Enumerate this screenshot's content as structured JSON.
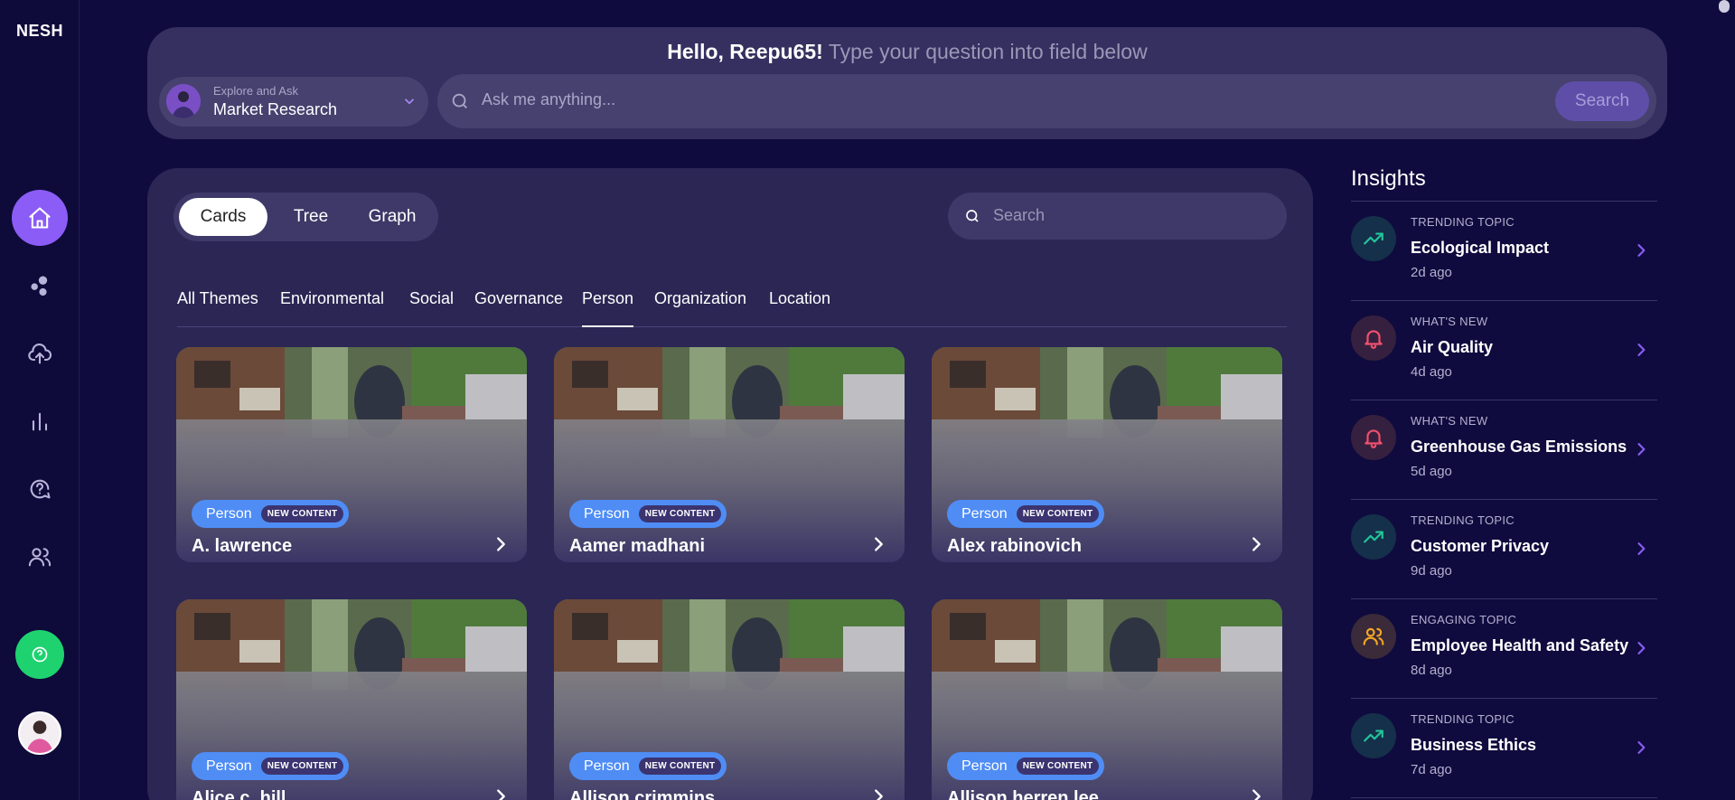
{
  "brand": {
    "name": "NESH"
  },
  "hero": {
    "greeting": "Hello, Reepu65!",
    "prompt": "Type your question into field below",
    "explore_small": "Explore and Ask",
    "explore_selected": "Market Research",
    "ask_placeholder": "Ask me anything...",
    "search_label": "Search"
  },
  "view_toggle": [
    "Cards",
    "Tree",
    "Graph"
  ],
  "main_search_placeholder": "Search",
  "themes": [
    "All Themes",
    "Environmental",
    "Social",
    "Governance",
    "Person",
    "Organization",
    "Location"
  ],
  "active_theme": "Person",
  "cards": [
    {
      "tag": "Person",
      "badge": "NEW CONTENT",
      "name": "A. lawrence"
    },
    {
      "tag": "Person",
      "badge": "NEW CONTENT",
      "name": "Aamer madhani"
    },
    {
      "tag": "Person",
      "badge": "NEW CONTENT",
      "name": "Alex rabinovich"
    },
    {
      "tag": "Person",
      "badge": "NEW CONTENT",
      "name": "Alice c. hill"
    },
    {
      "tag": "Person",
      "badge": "NEW CONTENT",
      "name": "Allison crimmins"
    },
    {
      "tag": "Person",
      "badge": "NEW CONTENT",
      "name": "Allison herren lee"
    }
  ],
  "insights": {
    "title": "Insights",
    "items": [
      {
        "kicker": "TRENDING TOPIC",
        "title": "Ecological Impact",
        "time": "2d ago",
        "icon": "trending-up-icon",
        "color": "#22c59a",
        "bg": "#15304a"
      },
      {
        "kicker": "WHAT'S NEW",
        "title": "Air Quality",
        "time": "4d ago",
        "icon": "bell-icon",
        "color": "#f0506e",
        "bg": "#36203f"
      },
      {
        "kicker": "WHAT'S NEW",
        "title": "Greenhouse Gas Emissions",
        "time": "5d ago",
        "icon": "bell-icon",
        "color": "#f0506e",
        "bg": "#36203f"
      },
      {
        "kicker": "TRENDING TOPIC",
        "title": "Customer Privacy",
        "time": "9d ago",
        "icon": "trending-up-icon",
        "color": "#22c59a",
        "bg": "#15304a"
      },
      {
        "kicker": "ENGAGING TOPIC",
        "title": "Employee Health and Safety",
        "time": "8d ago",
        "icon": "users-icon",
        "color": "#f5a623",
        "bg": "#3a2a3a"
      },
      {
        "kicker": "TRENDING TOPIC",
        "title": "Business Ethics",
        "time": "7d ago",
        "icon": "trending-up-icon",
        "color": "#22c59a",
        "bg": "#15304a"
      }
    ]
  }
}
